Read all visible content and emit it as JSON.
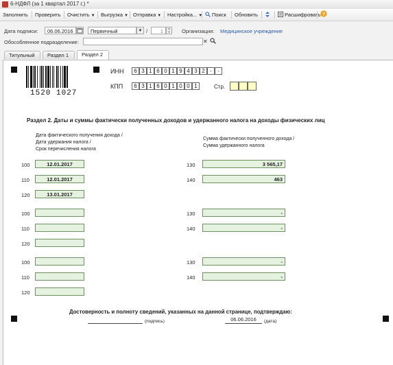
{
  "window": {
    "title": "6-НДФЛ (за 1 квартал 2017 г.) *"
  },
  "toolbar": {
    "fill": "Заполнить",
    "check": "Проверить",
    "clear": "Очистить",
    "export": "Выгрузка",
    "send": "Отправка",
    "settings": "Настройка...",
    "search": "Поиск",
    "refresh": "Обновить",
    "decode": "Расшифровать"
  },
  "header": {
    "sign_date_label": "Дата подписи:",
    "sign_date": "06.06.2016",
    "report_type": "Первичный",
    "slash": "/",
    "correction_no": "1",
    "org_label": "Организация:",
    "org_name": "Медицинское учреждение",
    "subdivision_label": "Обособленное подразделение:",
    "subdivision_value": ""
  },
  "tabs": [
    "Титульный",
    "Раздел 1",
    "Раздел 2"
  ],
  "form": {
    "barcode_number": "1520 1027",
    "inn_label": "ИНН",
    "inn_cells": [
      "6",
      "3",
      "1",
      "6",
      "0",
      "1",
      "9",
      "4",
      "3",
      "2",
      "-",
      "-"
    ],
    "kpp_label": "КПП",
    "kpp_cells": [
      "6",
      "3",
      "1",
      "6",
      "0",
      "1",
      "0",
      "0",
      "1"
    ],
    "page_label": "Стр.",
    "section_title": "Раздел 2.  Даты и суммы фактически полученных доходов и удержанного налога на доходы физических лиц",
    "left_header": [
      "Дата фактического получения дохода /",
      "Дата удержания налога /",
      "Срок перечисления налога"
    ],
    "right_header": [
      "Сумма фактически полученного дохода /",
      "Сумма удержанного налога"
    ],
    "blocks": [
      {
        "l100": "100",
        "v100": "12.01.2017",
        "l110": "110",
        "v110": "12.01.2017",
        "l120": "120",
        "v120": "13.01.2017",
        "l130": "130",
        "v130": "3 565,17",
        "l140": "140",
        "v140": "463"
      },
      {
        "l100": "100",
        "v100": "",
        "l110": "110",
        "v110": "",
        "l120": "120",
        "v120": "",
        "l130": "130",
        "v130": "-",
        "l140": "140",
        "v140": "-"
      },
      {
        "l100": "100",
        "v100": "",
        "l110": "110",
        "v110": "",
        "l120": "120",
        "v120": "",
        "l130": "130",
        "v130": "-",
        "l140": "140",
        "v140": "-"
      }
    ],
    "confirm_text": "Достоверность и полноту сведений, указанных на данной странице, подтверждаю:",
    "sign_caption": "(подпись)",
    "date_value": "06.06.2016",
    "date_caption": "(дата)"
  }
}
